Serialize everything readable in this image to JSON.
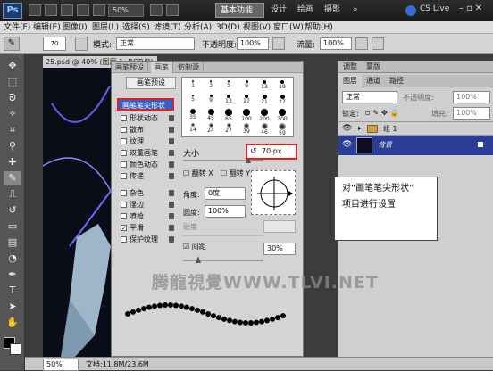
{
  "app": {
    "logo": "Ps",
    "zoom": "50%",
    "workspaces": [
      "基本功能",
      "设计",
      "绘画",
      "摄影"
    ],
    "cs_live": "CS Live"
  },
  "menu": [
    "文件(F)",
    "编辑(E)",
    "图像(I)",
    "图层(L)",
    "选择(S)",
    "滤镜(T)",
    "分析(A)",
    "3D(D)",
    "视图(V)",
    "窗口(W)",
    "帮助(H)"
  ],
  "options": {
    "brush_size": "70",
    "mode_label": "模式:",
    "mode_value": "正常",
    "opacity_label": "不透明度:",
    "opacity_value": "100%",
    "flow_label": "流量:",
    "flow_value": "100%"
  },
  "document": {
    "tab": "25.psd @ 40% (图层 1, RGB/8)",
    "status_zoom": "50%",
    "status_info": "文档:11.8M/23.6M"
  },
  "brush_panel": {
    "tabs": [
      "画笔预设",
      "画笔",
      "仿制源"
    ],
    "preset_button": "画笔预设",
    "tip_shape": "画笔笔尖形状",
    "options": [
      {
        "label": "形状动态",
        "checked": false
      },
      {
        "label": "散布",
        "checked": false
      },
      {
        "label": "纹理",
        "checked": false
      },
      {
        "label": "双重画笔",
        "checked": false
      },
      {
        "label": "颜色动态",
        "checked": false
      },
      {
        "label": "传递",
        "checked": false
      },
      {
        "label": "杂色",
        "checked": false
      },
      {
        "label": "湿边",
        "checked": false
      },
      {
        "label": "喷枪",
        "checked": false
      },
      {
        "label": "平滑",
        "checked": true
      },
      {
        "label": "保护纹理",
        "checked": false
      }
    ],
    "brush_sizes": [
      "1",
      "3",
      "5",
      "9",
      "13",
      "19",
      "5",
      "9",
      "13",
      "17",
      "21",
      "27",
      "35",
      "45",
      "65",
      "100",
      "200",
      "300",
      "14",
      "24",
      "27",
      "39",
      "46",
      "59"
    ],
    "size_label": "大小",
    "size_value": "70 px",
    "flip_x": "翻转 X",
    "flip_y": "翻转 Y",
    "angle_label": "角度:",
    "angle_value": "0度",
    "roundness_label": "圆度:",
    "roundness_value": "100%",
    "hardness_label": "硬度",
    "spacing_label": "间距",
    "spacing_value": "30%"
  },
  "layers_panel": {
    "tabs": [
      "调整",
      "蒙版"
    ],
    "tab2": [
      "图层",
      "通道",
      "路径"
    ],
    "blend_mode": "正常",
    "opacity_label": "不透明度:",
    "opacity_value": "100%",
    "lock_label": "锁定:",
    "fill_label": "填充:",
    "fill_value": "100%",
    "group": "组 1",
    "background": "背景"
  },
  "callout": {
    "line1": "对“画笔笔尖形状”",
    "line2": "项目进行设置"
  },
  "watermark": "腾龍視覺WWW.TLVI.NET",
  "colors": {
    "accent_blue": "#2b3d94",
    "highlight_red": "#e02020",
    "glow": "#6a6aff"
  }
}
